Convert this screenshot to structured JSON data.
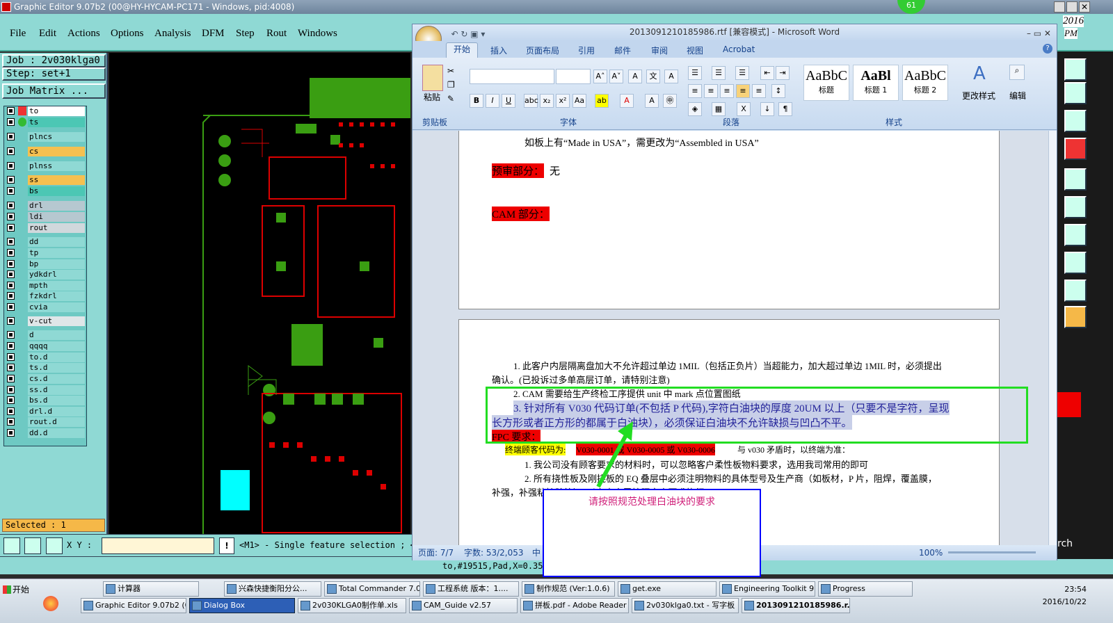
{
  "ge": {
    "title": "Graphic Editor 9.07b2 (00@HY-HYCAM-PC171 - Windows, pid:4008)",
    "menu": [
      "File",
      "Edit",
      "Actions",
      "Options",
      "Analysis",
      "DFM",
      "Step",
      "Rout",
      "Windows"
    ],
    "job": "Job : 2v030klga0",
    "step": "Step: set+1",
    "job_matrix": "Job Matrix ...",
    "layers": [
      "to",
      "ts",
      "plncs",
      "cs",
      "plnss",
      "ss",
      "bs",
      "drl",
      "ldi",
      "rout",
      "dd",
      "tp",
      "bp",
      "ydkdrl",
      "mpth",
      "fzkdrl",
      "cvia",
      "v-cut",
      "d",
      "qqqq",
      "to.d",
      "ts.d",
      "cs.d",
      "ss.d",
      "bs.d",
      "drl.d",
      "rout.d",
      "dd.d"
    ],
    "selected": "Selected : 1",
    "xy_label": "X Y :",
    "hint": "<M1> - Single feature selection ; <M",
    "status": "to,#19515,Pad,X=0.35,"
  },
  "word": {
    "title": "2013091210185986.rtf [兼容模式] - Microsoft Word",
    "tabs": [
      "开始",
      "插入",
      "页面布局",
      "引用",
      "邮件",
      "审阅",
      "视图",
      "Acrobat"
    ],
    "groups": {
      "clipboard": "剪贴板",
      "font": "字体",
      "paragraph": "段落",
      "styles": "样式"
    },
    "paste": "粘贴",
    "styles": [
      {
        "sample": "AaBbC",
        "name": "标题"
      },
      {
        "sample": "AaBl",
        "name": "标题 1"
      },
      {
        "sample": "AaBbC",
        "name": "标题 2"
      }
    ],
    "change_styles": "更改样式",
    "edit": "编辑",
    "doc": {
      "l1": "如板上有“Made in USA”，需更改为“Assembled in USA”",
      "prereview_label": "预审部分：",
      "prereview_value": "无",
      "cam_label": "CAM 部分：",
      "p1": "1. 此客户内层隔离盘加大不允许超过单边 1MIL（包括正负片）当超能力，加大超过单边 1MIL 时，必须提出",
      "p1b": "确认。(已投诉过多单高层订单，请特别注意)",
      "p2": "2. CAM 需要给生产终检工序提供 unit 中 mark 点位置图纸",
      "p3": "3. 针对所有 V030 代码订单(不包括 P 代码),字符白油块的厚度 20UM 以上（只要不是字符，呈现",
      "p3b": "长方形或者正方形的都属于白油块），必须保证白油块不允许缺损与凹凸不平。",
      "fpc_label": "FPC 要求：",
      "fpc1_label": "终端顾客代码为:",
      "fpc1_red": "V030-0001 或 V030-0005 或 V030-0006",
      "fpc1_end": "与 v030 矛盾时，以终端为准：",
      "fpc2": "1. 我公司没有顾客要求的材料时，可以忽略客户柔性板物料要求，选用我司常用的即可",
      "fpc3": "2. 所有挠性板及刚挠板的 EQ 叠层中必须注明物料的具体型号及生产商（如板材，P 片，阻焊，覆盖膜，",
      "fpc3b": "补强，补强粘接胶等），以上内容需按照客户要求执行。"
    },
    "status": {
      "page": "页面: 7/7",
      "words": "字数: 53/2,053",
      "lang": "中",
      "zoom": "100%"
    }
  },
  "dialog": {
    "text": "请按照规范处理白油块的要求"
  },
  "taskbar": {
    "start": "开始",
    "row1": [
      "计算器",
      "兴森快捷衡阳分公...",
      "Total Commander 7.0...",
      "工程系统  版本：1....",
      "制作规范 (Ver:1.0.6)",
      "get.exe",
      "Engineering Toolkit 9....",
      "Progress"
    ],
    "row2": [
      "Graphic Editor 9.07b2 (0...",
      "Dialog Box",
      "2v030KLGA0制作单.xls",
      "CAM_Guide v2.57",
      "拼板.pdf - Adobe Reader",
      "2v030klga0.txt - 写字板",
      "2013091210185986.r..."
    ],
    "time": "23:54",
    "date": "2016/10/22"
  },
  "side_text": {
    "year": "2016",
    "pm": "PM",
    "badge": "61",
    "rch": "rch"
  }
}
